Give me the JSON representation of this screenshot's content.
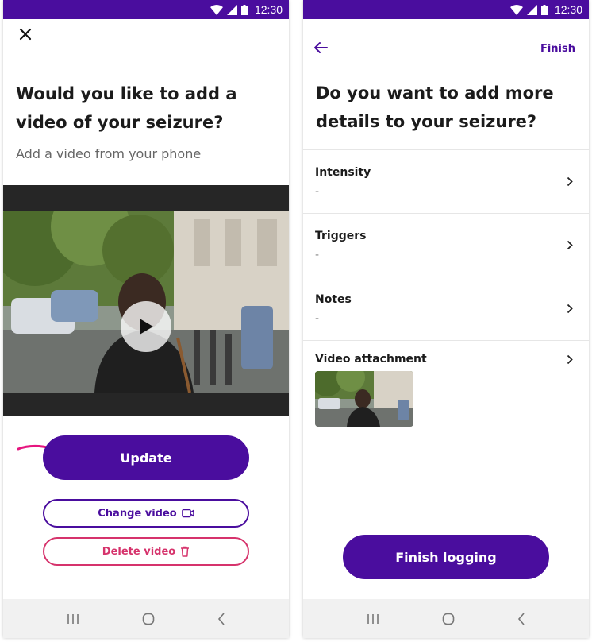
{
  "colors": {
    "brand": "#4a0d9e",
    "danger": "#d6336c",
    "accent_pink": "#e6157f"
  },
  "status_bar": {
    "time": "12:30"
  },
  "left_screen": {
    "title": "Would you like to add a video of your seizure?",
    "subtitle": "Add a video from your phone",
    "update_label": "Update",
    "change_video_label": "Change video",
    "delete_video_label": "Delete video"
  },
  "right_screen": {
    "finish_link": "Finish",
    "title": "Do you want to add more details to your seizure?",
    "rows": [
      {
        "label": "Intensity",
        "value": "-"
      },
      {
        "label": "Triggers",
        "value": "-"
      },
      {
        "label": "Notes",
        "value": "-"
      },
      {
        "label": "Video attachment"
      }
    ],
    "finish_logging_label": "Finish logging"
  },
  "icons": {
    "close": "close-icon",
    "play": "play-icon",
    "back": "arrow-left-icon",
    "chevron": "chevron-right-icon",
    "video_camera": "video-camera-icon",
    "trash": "trash-icon",
    "wifi": "wifi-icon",
    "signal": "signal-icon",
    "battery": "battery-icon"
  }
}
